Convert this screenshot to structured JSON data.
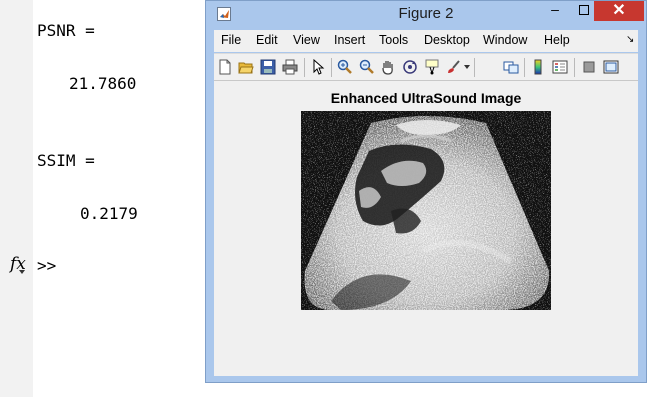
{
  "command_window": {
    "lines": [
      {
        "id": "psnr_label",
        "text": "PSNR ="
      },
      {
        "id": "psnr_value",
        "text": "21.7860"
      },
      {
        "id": "ssim_label",
        "text": "SSIM ="
      },
      {
        "id": "ssim_value",
        "text": "0.2179"
      }
    ],
    "prompt": ">>",
    "fx_icon": "fx"
  },
  "figure": {
    "title": "Figure 2",
    "controls": {
      "minimize": "–",
      "close": "✕"
    },
    "menus": [
      "File",
      "Edit",
      "View",
      "Insert",
      "Tools",
      "Desktop",
      "Window",
      "Help"
    ],
    "menu_overflow_icon": "dock-arrow-icon",
    "toolbar_icons": [
      "new-figure-icon",
      "open-file-icon",
      "save-icon",
      "print-icon",
      "pointer-icon",
      "zoom-in-icon",
      "zoom-out-icon",
      "pan-icon",
      "rotate-3d-icon",
      "data-cursor-icon",
      "brush-icon",
      "link-plot-icon",
      "colorbar-icon",
      "legend-icon",
      "hide-plot-tools-icon",
      "show-plot-tools-icon"
    ],
    "axes_title": "Enhanced UltraSound Image",
    "image_icon": "ultrasound-image"
  },
  "colors": {
    "titlebar": "#aac7ec",
    "close_button": "#c7372f",
    "figure_background": "#f0f0f0",
    "gutter": "#f2f2f2"
  }
}
